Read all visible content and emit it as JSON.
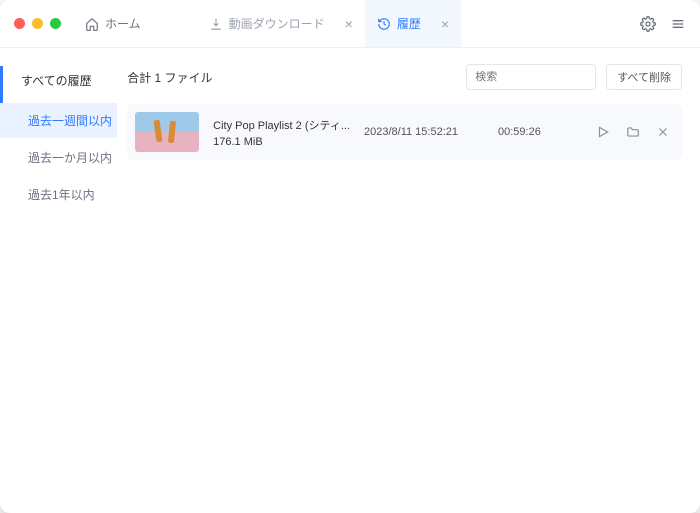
{
  "titlebar": {
    "home_label": "ホーム",
    "tabs": [
      {
        "label": "動画ダウンロード",
        "active": false
      },
      {
        "label": "履歴",
        "active": true
      }
    ]
  },
  "sidebar": {
    "title": "すべての履歴",
    "items": [
      {
        "label": "過去一週間以内",
        "active": true
      },
      {
        "label": "過去一か月以内",
        "active": false
      },
      {
        "label": "過去1年以内",
        "active": false
      }
    ]
  },
  "main": {
    "total_label": "合計 1 ファイル",
    "search_placeholder": "検索",
    "clear_all_label": "すべて削除"
  },
  "rows": [
    {
      "title": "City Pop Playlist 2 (シティ...",
      "size": "176.1 MiB",
      "date": "2023/8/11 15:52:21",
      "duration": "00:59:26"
    }
  ]
}
